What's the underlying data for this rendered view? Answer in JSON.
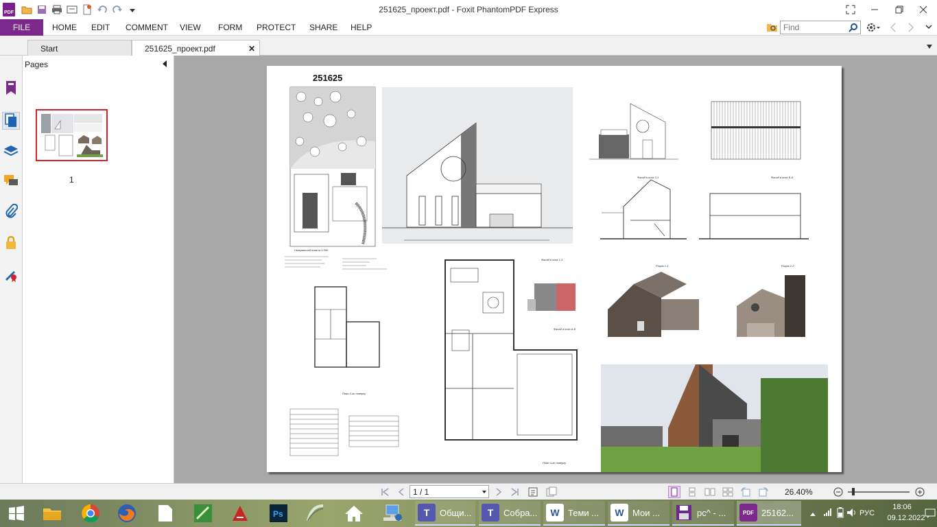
{
  "window": {
    "title": "251625_проект.pdf - Foxit PhantomPDF Express",
    "logo_text": "PDF"
  },
  "menu": {
    "file": "FILE",
    "items": [
      "HOME",
      "EDIT",
      "COMMENT",
      "VIEW",
      "FORM",
      "PROTECT",
      "SHARE",
      "HELP"
    ],
    "find_placeholder": "Find"
  },
  "tabs": {
    "start": "Start",
    "document": "251625_проект.pdf"
  },
  "pages_panel": {
    "title": "Pages",
    "thumbnail_label": "1"
  },
  "document": {
    "heading": "251625",
    "labels": {
      "site_plan": "Генеральний план м 1:300",
      "facade_1_3": "Фасад в осях 1-3",
      "facade_3_1": "Фасад в осях 3-1",
      "facade_b_a": "Фасад в осях Б-А",
      "facade_a_b": "Фасад в осях А-Б",
      "section_1_1": "Розріз 1-1",
      "section_2_2": "Розріз 2-2",
      "plan_2": "План 2-го поверху",
      "plan_1": "План 1-го поверху"
    }
  },
  "navbar": {
    "page_value": "1 / 1",
    "zoom": "26.40%"
  },
  "taskbar": {
    "tasks": [
      {
        "label": "Общи...",
        "icon": "T"
      },
      {
        "label": "Собра...",
        "icon": "T"
      },
      {
        "label": "Теми ...",
        "icon": "W"
      },
      {
        "label": "Мои ...",
        "icon": "W"
      },
      {
        "label": "pc^ - ...",
        "icon": "disk"
      },
      {
        "label": "25162...",
        "icon": "PDF"
      }
    ],
    "language": "РУС",
    "time": "18:06",
    "date": "09.12.2022"
  },
  "colors": {
    "brand": "#7b2a8c",
    "thumb_selection": "#d2232a",
    "doc_background": "#a8a8a8"
  }
}
